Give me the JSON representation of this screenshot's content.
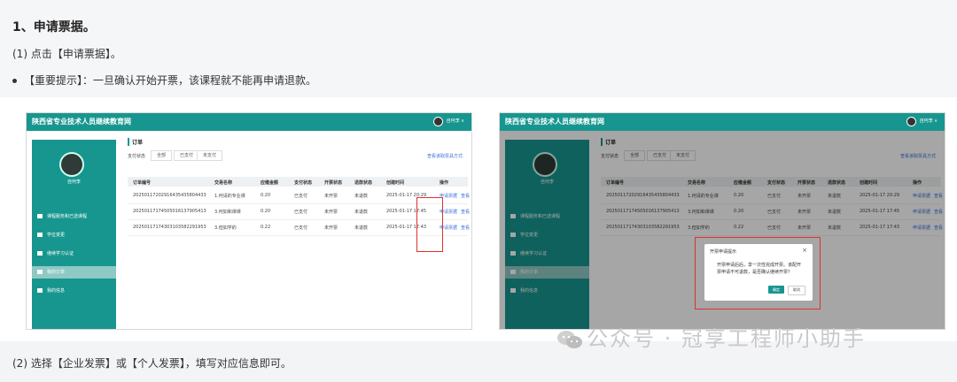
{
  "step": {
    "heading": "1、申请票据。",
    "instruction1": "(1) 点击【申请票据】。",
    "tip": "【重要提示】：一旦确认开始开票，该课程就不能再申请退款。",
    "instruction2": "(2) 选择【企业发票】或【个人发票】，填写对应信息即可。"
  },
  "screenshot": {
    "site_title": "陕西省专业技术人员继续教育网",
    "user_menu": "自何李 ∨",
    "user_name": "自何李",
    "sidebar": [
      "课程服务和已选课程",
      "学位变更",
      "继续学习认证",
      "我的订单",
      "我的信息"
    ],
    "page_title": "订单",
    "filter_label": "支付状态",
    "filter_tabs": [
      "全部",
      "已支付",
      "未支付"
    ],
    "invoice_link": "查看该取票具方式",
    "columns": [
      "订单编号",
      "交易名称",
      "应缴金额",
      "支付状态",
      "开票状态",
      "退款状态",
      "创建时间",
      "操作"
    ],
    "rows": [
      [
        "20250117202916435435804433",
        "1.何请的专业课",
        "0.20",
        "已支付",
        "未开票",
        "未退款",
        "2025-01-17 20:29",
        "申请票据",
        "查看"
      ],
      [
        "20250117174505016137905413",
        "3.何如和课课",
        "0.20",
        "已支付",
        "未开票",
        "未退款",
        "2025-01-17 17:45",
        "申请票据",
        "查看"
      ],
      [
        "20250117174303103582291953",
        "3.但如学的",
        "0.22",
        "已支付",
        "未开票",
        "未退款",
        "2025-01-17 17:43",
        "申请票据",
        "查看"
      ]
    ],
    "dialog": {
      "title": "开票申请提示",
      "close": "×",
      "message": "开票申请后后，享一次性完成开票。该配开票申请不可退款，是否确认继续开票？",
      "confirm": "确定",
      "cancel": "取消"
    }
  },
  "watermark": "公众号 · 冠享工程师小助手",
  "colors": {
    "brand": "#17968f",
    "highlight": "#e0312f",
    "link": "#3a6fd8"
  }
}
